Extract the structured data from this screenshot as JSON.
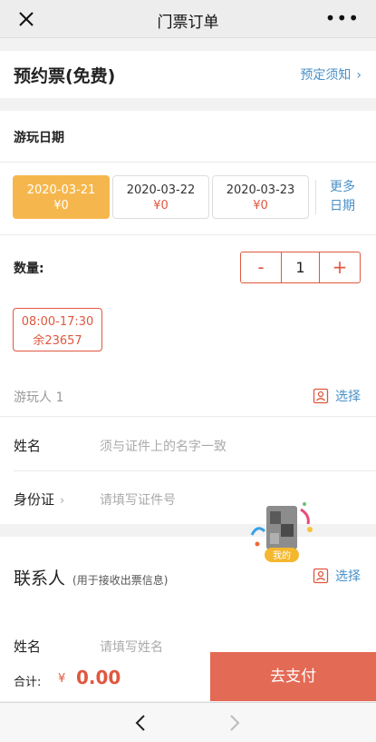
{
  "nav": {
    "title": "门票订单",
    "more": "•••"
  },
  "ticket": {
    "name": "预约票(免费)",
    "notice_link": "预定须知"
  },
  "play_date": {
    "label": "游玩日期",
    "dates": [
      {
        "date": "2020-03-21",
        "price": "¥0",
        "selected": true
      },
      {
        "date": "2020-03-22",
        "price": "¥0",
        "selected": false
      },
      {
        "date": "2020-03-23",
        "price": "¥0",
        "selected": false
      }
    ],
    "more_line1": "更多",
    "more_line2": "日期"
  },
  "quantity": {
    "label": "数量:",
    "minus": "-",
    "value": "1",
    "plus": "+"
  },
  "time_slot": {
    "time": "08:00-17:30",
    "remaining": "余23657"
  },
  "visitor": {
    "header": "游玩人 1",
    "pick": "选择",
    "name_label": "姓名",
    "name_placeholder": "须与证件上的名字一致",
    "id_label": "身份证",
    "id_placeholder": "请填写证件号"
  },
  "contact": {
    "title": "联系人",
    "subtitle": "(用于接收出票信息)",
    "pick": "选择",
    "name_label": "姓名",
    "name_placeholder": "请填写姓名"
  },
  "floating_badge": {
    "label": "我的"
  },
  "footer": {
    "total_label": "合计:",
    "currency": "¥",
    "total": "0.00",
    "pay": "去支付"
  },
  "colors": {
    "accent_red": "#e0573f",
    "selected_date": "#f5b74d",
    "link_blue": "#4a90c8",
    "pay_button": "#e36a55"
  }
}
